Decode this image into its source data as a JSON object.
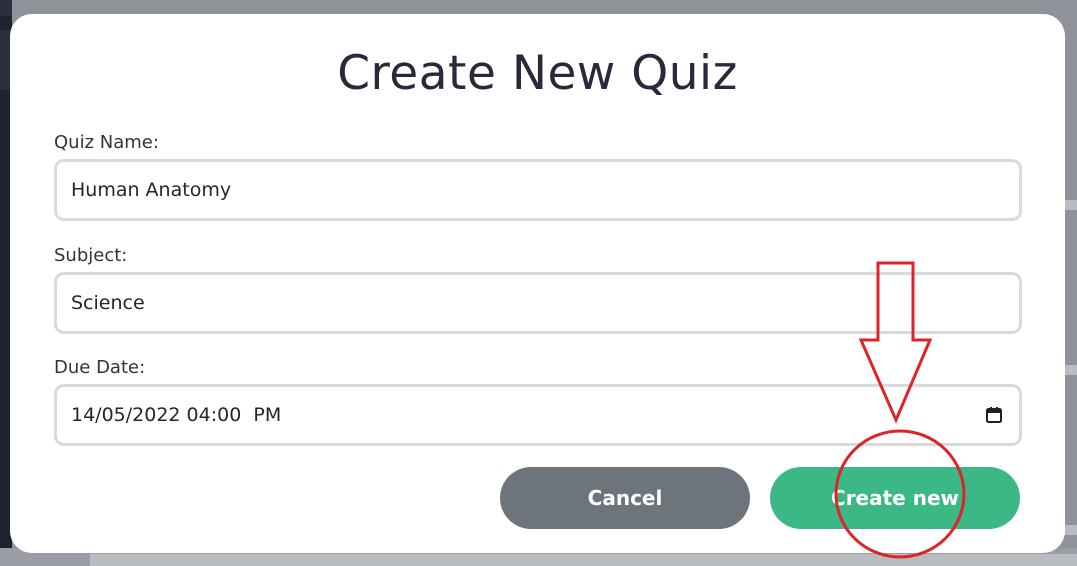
{
  "modal": {
    "title": "Create New Quiz"
  },
  "form": {
    "quiz_name_label": "Quiz Name:",
    "quiz_name_value": "Human Anatomy",
    "subject_label": "Subject:",
    "subject_value": "Science",
    "due_date_label": "Due Date:",
    "due_date_value": "14/05/2022 04:00  PM"
  },
  "actions": {
    "cancel_label": "Cancel",
    "create_label": "Create new"
  },
  "icons": {
    "date_picker": "calendar-icon",
    "annotation_arrow": "arrow-down-icon",
    "annotation_circle": "circle-highlight"
  },
  "colors": {
    "create_button": "#3cb886",
    "cancel_button": "#6e747b",
    "annotation": "#e0222b",
    "title": "#262a3b"
  }
}
